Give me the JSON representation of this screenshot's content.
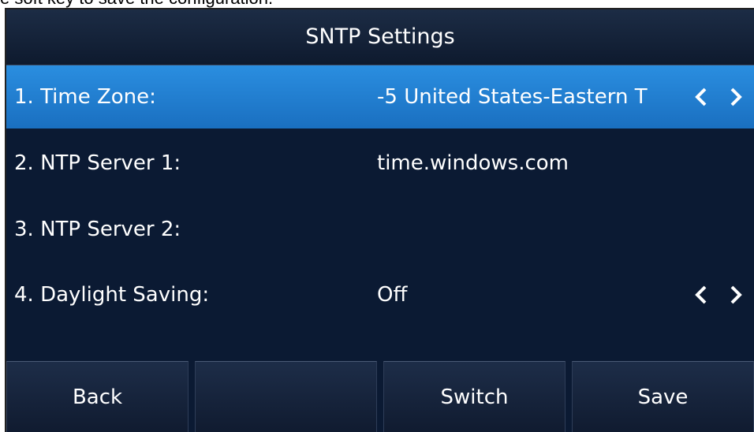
{
  "caption": "e soft key to save the configuration.",
  "title": "SNTP Settings",
  "rows": [
    {
      "label": "1. Time Zone:",
      "value": "-5 United States-Eastern T",
      "selected": true,
      "arrows": true
    },
    {
      "label": "2. NTP Server 1:",
      "value": "time.windows.com",
      "selected": false,
      "arrows": false
    },
    {
      "label": "3. NTP Server 2:",
      "value": "",
      "selected": false,
      "arrows": false
    },
    {
      "label": "4. Daylight Saving:",
      "value": "Off",
      "selected": false,
      "arrows": true
    }
  ],
  "softkeys": [
    "Back",
    "",
    "Switch",
    "Save"
  ],
  "colors": {
    "background": "#0b1a33",
    "selected": "#2a8ee0",
    "text": "#ffffff"
  }
}
